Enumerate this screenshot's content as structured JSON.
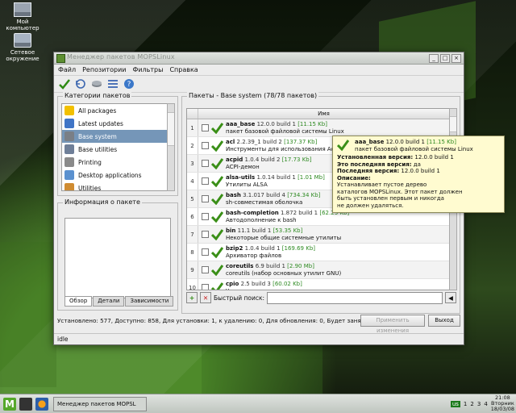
{
  "desktop": {
    "icons": [
      {
        "label_line1": "Мой",
        "label_line2": "компьютер"
      },
      {
        "label_line1": "Сетевое",
        "label_line2": "окружение"
      }
    ]
  },
  "window": {
    "title": "Менеджер пакетов MOPSLinux",
    "menu": [
      "Файл",
      "Репозитории",
      "Фильтры",
      "Справка"
    ],
    "toolbar_icons": [
      "apply-icon",
      "undo-icon",
      "disk-icon",
      "list-icon",
      "help-icon"
    ]
  },
  "categories": {
    "title": "Категории пакетов",
    "items": [
      "All packages",
      "Latest updates",
      "Base system",
      "Base utilities",
      "Printing",
      "Desktop applications",
      "Utilities"
    ],
    "selected": "Base system",
    "icon_colors": [
      "#f2c000",
      "#3f74c6",
      "#7a7f86",
      "#6f7f98",
      "#8a8a8a",
      "#5b91cf",
      "#d08c32"
    ]
  },
  "info": {
    "title": "Информация о пакете",
    "tabs": [
      "Обзор",
      "Детали",
      "Зависимости"
    ],
    "active_tab": "Обзор"
  },
  "packages": {
    "title": "Пакеты - Base system",
    "count": "(78/78 пакетов)",
    "header": "Имя",
    "rows": [
      {
        "num": "1",
        "name": "aaa_base",
        "ver": "12.0.0 build 1",
        "size": "[11.15 Kb]",
        "desc": "пакет базовой файловой системы Linux"
      },
      {
        "num": "2",
        "name": "acl",
        "ver": "2.2.39_1 build 2",
        "size": "[137.37 Kb]",
        "desc": "Инструменты для использования Access Control"
      },
      {
        "num": "3",
        "name": "acpid",
        "ver": "1.0.4 build 2",
        "size": "[17.73 Kb]",
        "desc": "ACPI-демон"
      },
      {
        "num": "4",
        "name": "alsa-utils",
        "ver": "1.0.14 build 1",
        "size": "[1.01 Mb]",
        "desc": "Утилиты ALSA"
      },
      {
        "num": "5",
        "name": "bash",
        "ver": "3.1.017 build 4",
        "size": "[734.34 Kb]",
        "desc": "sh-совместимая оболочка"
      },
      {
        "num": "6",
        "name": "bash-completion",
        "ver": "1.872 build 1",
        "size": "[62.23 Kb]",
        "desc": "Автодополнение к bash"
      },
      {
        "num": "7",
        "name": "bin",
        "ver": "11.1 build 1",
        "size": "[53.35 Kb]",
        "desc": "Некоторые общие системные утилиты"
      },
      {
        "num": "8",
        "name": "bzip2",
        "ver": "1.0.4 build 1",
        "size": "[169.69 Kb]",
        "desc": "Архиватор файлов"
      },
      {
        "num": "9",
        "name": "coreutils",
        "ver": "6.9 build 1",
        "size": "[2.90 Mb]",
        "desc": "coreutils (набор основных утилит GNU)"
      },
      {
        "num": "10",
        "name": "cpio",
        "ver": "2.5 build 3",
        "size": "[60.02 Kb]",
        "desc": "Утилита резервного копирования и архивирования"
      }
    ]
  },
  "tooltip": {
    "name": "aaa_base",
    "ver": "12.0.0 build 1",
    "size": "[11.15 Kb]",
    "desc_short": "пакет базовой файловой системы Linux",
    "installed_label": "Установленная версия:",
    "installed_value": "12.0.0 build 1",
    "latest_q_label": "Это последняя версия:",
    "latest_q_value": "да",
    "latest_label": "Последняя версия:",
    "latest_value": "12.0.0 build 1",
    "desc_label": "Описание:",
    "desc_lines": [
      "Устанавливает пустое дерево",
      "каталогов MOPSLinux. Этот пакет должен",
      "быть установлен первым и никогда",
      "не должен удаляться."
    ]
  },
  "search": {
    "label": "Быстрый поиск:",
    "value": ""
  },
  "status": {
    "summary": "Установлено: 577, Доступно: 858, Для установки: 1, к удалению: 0, Для обновления: 0, Будет занято: 320.20 Mb",
    "apply": "Применить изменения",
    "exit": "Выход",
    "state": "idle"
  },
  "taskbar": {
    "task": "Менеджер пакетов MOPSL",
    "lang": "us",
    "num1": "1",
    "num2": "2",
    "num3": "3",
    "num4": "4",
    "clock_time": "21:08",
    "clock_day": "Вторник",
    "clock_date": "18/03/08"
  },
  "colors": {
    "accent_green": "#3a8f17",
    "selection": "#7596b8",
    "tooltip_bg": "#fffbd0"
  }
}
